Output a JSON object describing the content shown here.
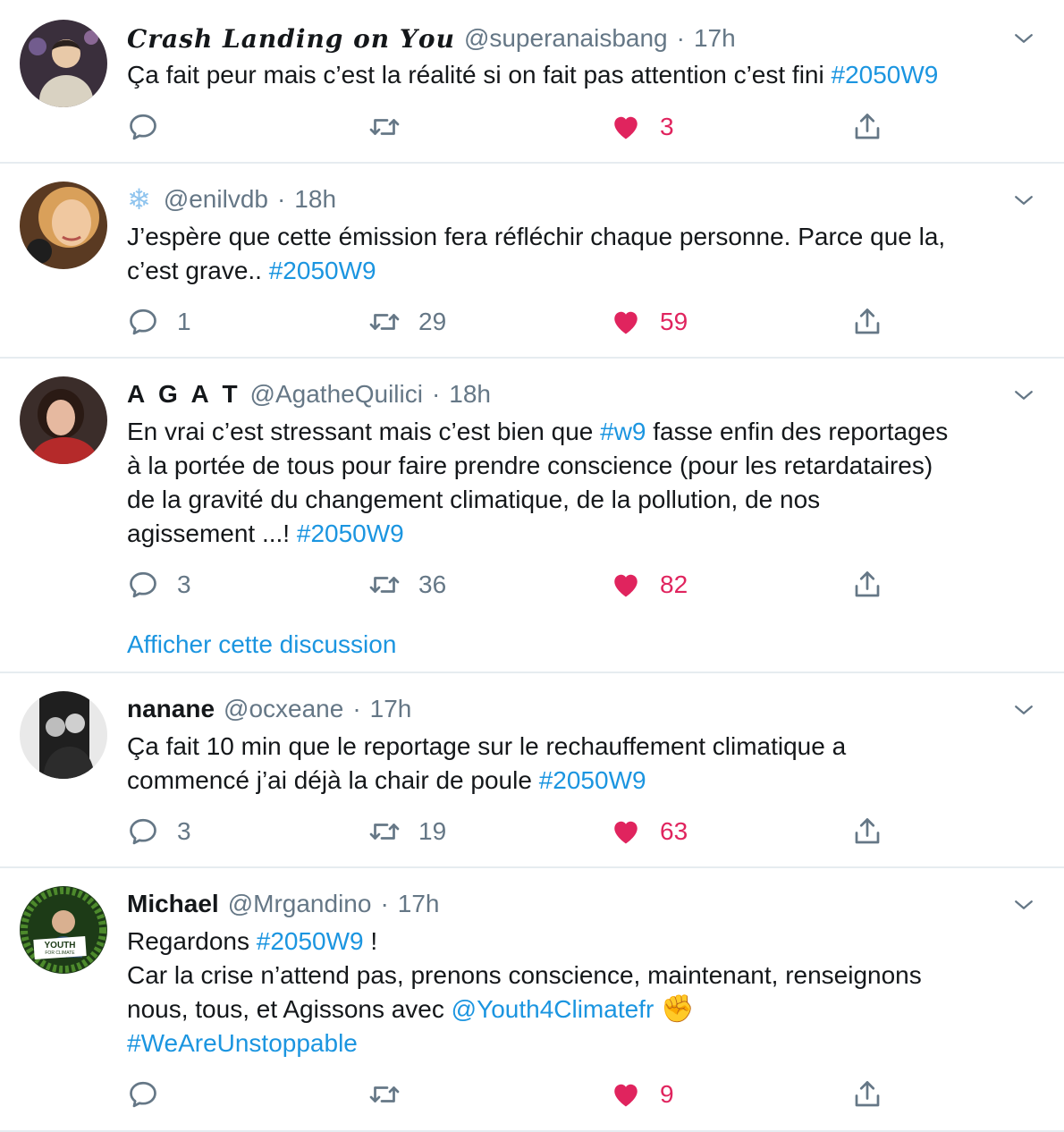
{
  "tweets": [
    {
      "name": "𝑪𝒓𝒂𝒔𝒉 𝑳𝒂𝒏𝒅𝒊𝒏𝒈 𝒐𝒏 𝒀𝒐𝒖",
      "handle": "@superanaisbang",
      "time": "17h",
      "text": "Ça fait peur mais c’est la réalité si on fait pas attention c’est fini ",
      "hashtag": "#2050W9",
      "replies": "",
      "retweets": "",
      "likes": "3"
    },
    {
      "name_icon": "snowflake-icon",
      "handle": "@enilvdb",
      "time": "18h",
      "line1": "J’espère que cette émission fera réfléchir chaque personne. Parce que la,",
      "line2": "c’est grave.. ",
      "hashtag": "#2050W9",
      "replies": "1",
      "retweets": "29",
      "likes": "59"
    },
    {
      "name": "A G A T",
      "handle": "@AgatheQuilici",
      "time": "18h",
      "line1_a": "En vrai c’est stressant mais c’est bien que ",
      "mention_tag": "#w9",
      "line1_b": " fasse enfin des reportages",
      "line2": "à la portée de tous pour faire prendre conscience (pour les retardataires)",
      "line3": "de la gravité du changement climatique, de la pollution, de nos",
      "line4": "agissement ...! ",
      "hashtag": "#2050W9",
      "replies": "3",
      "retweets": "36",
      "likes": "82",
      "thread_link": "Afficher cette discussion"
    },
    {
      "name": "nanane",
      "handle": "@ocxeane",
      "time": "17h",
      "line1": "Ça fait 10 min que le reportage sur le rechauffement climatique a",
      "line2": "commencé j’ai déjà la chair de poule ",
      "hashtag": "#2050W9",
      "replies": "3",
      "retweets": "19",
      "likes": "63"
    },
    {
      "name": "Michael",
      "handle": "@Mrgandino",
      "time": "17h",
      "line1_a": "Regardons ",
      "hashtag": "#2050W9",
      "line1_b": " !",
      "line2": "Car la crise n’attend pas, prenons conscience, maintenant, renseignons",
      "line3": "nous, tous, et Agissons avec ",
      "mention": "@Youth4Climatefr",
      "emoji": "✊",
      "hashtag2": "#WeAreUnstoppable",
      "avatar_text": "YOUTH",
      "avatar_subtext": "FOR CLIMATE",
      "avatar_subtext2": "FRANCE",
      "replies": "",
      "retweets": "",
      "likes": "9"
    }
  ],
  "colors": {
    "link": "#1b95e0",
    "like": "#e0245e",
    "muted": "#657786",
    "divider": "#e6ecf0"
  }
}
